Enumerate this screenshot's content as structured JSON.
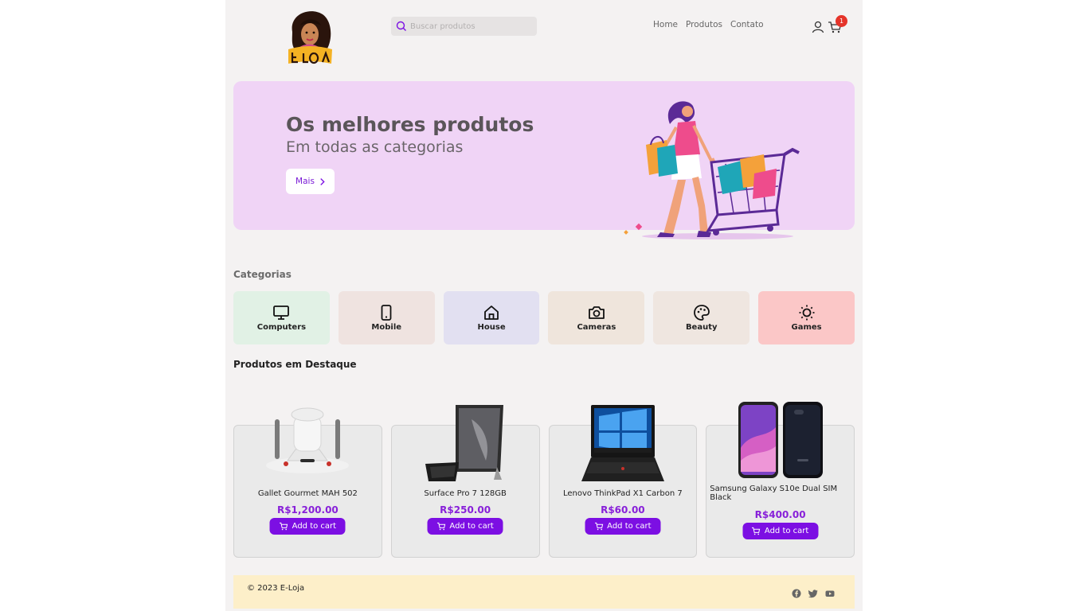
{
  "header": {
    "logo_text": "E-Loja",
    "search": {
      "placeholder": "Buscar produtos"
    },
    "nav": [
      "Home",
      "Produtos",
      "Contato"
    ],
    "cart_count": "1"
  },
  "hero": {
    "title": "Os melhores produtos",
    "subtitle": "Em todas as categorias",
    "button_label": "Mais"
  },
  "categories": {
    "title": "Categorias",
    "items": [
      {
        "label": "Computers",
        "icon": "monitor-icon",
        "color": "#e1f1e5"
      },
      {
        "label": "Mobile",
        "icon": "smartphone-icon",
        "color": "#efe3e0"
      },
      {
        "label": "House",
        "icon": "house-icon",
        "color": "#e2e0f1"
      },
      {
        "label": "Cameras",
        "icon": "camera-icon",
        "color": "#efe5dc"
      },
      {
        "label": "Beauty",
        "icon": "palette-icon",
        "color": "#efe6e0"
      },
      {
        "label": "Games",
        "icon": "sun-icon",
        "color": "#fbc7c7"
      }
    ]
  },
  "products": {
    "title": "Produtos em Destaque",
    "add_label": "Add to cart",
    "items": [
      {
        "name": "Gallet Gourmet MAH 502",
        "price": "R$1,200.00",
        "image": "coffee-maker"
      },
      {
        "name": "Surface Pro 7 128GB",
        "price": "R$250.00",
        "image": "tablet"
      },
      {
        "name": "Lenovo ThinkPad X1 Carbon 7",
        "price": "R$60.00",
        "image": "laptop"
      },
      {
        "name": "Samsung Galaxy S10e Dual SIM Black",
        "price": "R$400.00",
        "image": "smartphone"
      }
    ]
  },
  "footer": {
    "copyright": "© 2023 E-Loja",
    "socials": [
      "facebook-icon",
      "twitter-icon",
      "youtube-icon"
    ]
  },
  "colors": {
    "accent": "#7c0fe3",
    "price": "#8820d9",
    "hero_bg": "#f0d4f6",
    "footer_bg": "#fdefc9",
    "badge": "#e5342a"
  }
}
